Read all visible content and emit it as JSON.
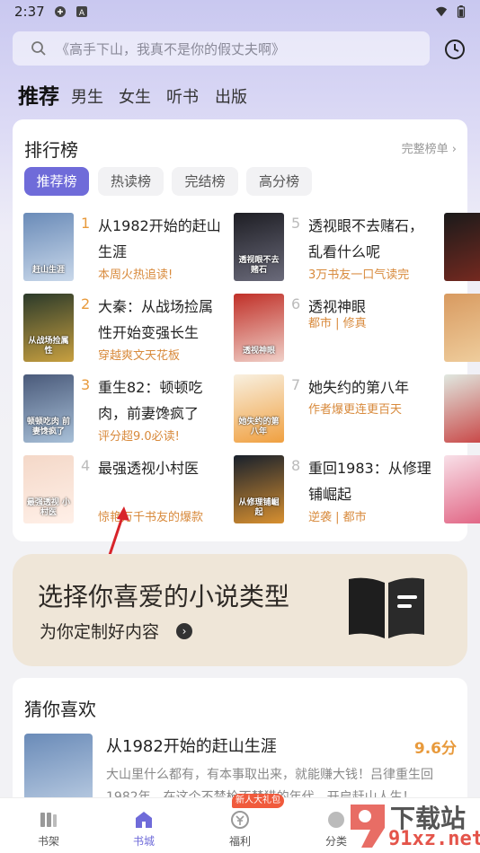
{
  "status": {
    "time": "2:37"
  },
  "search": {
    "placeholder": "《高手下山，我真不是你的假丈夫啊》"
  },
  "nav_tabs": [
    "推荐",
    "男生",
    "女生",
    "听书",
    "出版"
  ],
  "ranking": {
    "title": "排行榜",
    "more": "完整榜单",
    "pills": [
      "推荐榜",
      "热读榜",
      "完结榜",
      "高分榜"
    ],
    "books": [
      {
        "rank": "1",
        "title": "从1982开始的赶山生涯",
        "tag": "本周火热追读!",
        "cover_text": "赶山生涯",
        "colors": [
          "#6a8bb8",
          "#c9d8ea"
        ]
      },
      {
        "rank": "2",
        "title": "大秦：从战场捡属性开始变强长生",
        "tag": "穿越爽文天花板",
        "cover_text": "从战场捡属性",
        "colors": [
          "#2b3a2a",
          "#c8a040"
        ]
      },
      {
        "rank": "3",
        "title": "重生82：顿顿吃肉，前妻馋疯了",
        "tag": "评分超9.0必读!",
        "cover_text": "顿顿吃肉 前妻馋疯了",
        "colors": [
          "#4a5a7a",
          "#a8c0d8"
        ]
      },
      {
        "rank": "4",
        "title": "最强透视小村医",
        "tag": "惊艳万千书友的爆款",
        "cover_text": "最强透视 小村医",
        "colors": [
          "#f4d8c8",
          "#fff0e8"
        ]
      },
      {
        "rank": "5",
        "title": "透视眼不去赌石，乱看什么呢",
        "tag": "3万书友一口气读完",
        "cover_text": "透视眼不去赌石",
        "colors": [
          "#1e1e24",
          "#6a6a7a"
        ]
      },
      {
        "rank": "6",
        "title": "透视神眼",
        "tag": "都市 | 修真",
        "cover_text": "透视神眼",
        "colors": [
          "#c03028",
          "#f0d0c8"
        ]
      },
      {
        "rank": "7",
        "title": "她失约的第八年",
        "tag": "作者爆更连更百天",
        "cover_text": "她失约的第八年",
        "colors": [
          "#f8f0e0",
          "#f0a040"
        ]
      },
      {
        "rank": "8",
        "title": "重回1983：从修理铺崛起",
        "tag": "逆袭 | 都市",
        "cover_text": "从修理铺崛起",
        "colors": [
          "#18202c",
          "#d89030"
        ]
      }
    ]
  },
  "genre_banner": {
    "title": "选择你喜爱的小说类型",
    "subtitle": "为你定制好内容"
  },
  "guess": {
    "title": "猜你喜欢",
    "book": {
      "title": "从1982开始的赶山生涯",
      "score": "9.6分",
      "desc": "大山里什么都有，有本事取出来，就能赚大钱！吕律重生回1982年，在这个不禁枪不禁猎的年代，开启赶山人生！"
    }
  },
  "bottom_nav": {
    "items": [
      "书架",
      "书城",
      "福利",
      "分类"
    ],
    "badge": "新人大礼包"
  },
  "watermark": {
    "line1": "下载站",
    "line2": "91xz.net"
  },
  "colors": {
    "accent": "#6f6bd9",
    "tag": "#d88a3c",
    "top_rank": "#e89a3c",
    "arrow": "#d8242a"
  }
}
